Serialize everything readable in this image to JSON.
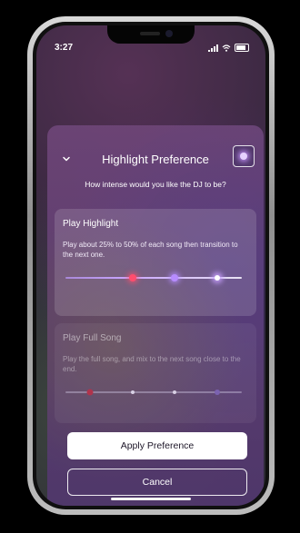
{
  "status_bar": {
    "time": "3:27"
  },
  "sheet": {
    "title": "Highlight Preference",
    "subtitle": "How intense would you like the DJ to be?"
  },
  "options": [
    {
      "title": "Play Highlight",
      "description": "Play about 25% to 50% of each song then transition to the next one.",
      "selected": true
    },
    {
      "title": "Play Full Song",
      "description": "Play the full song, and mix to the next song close to the end.",
      "selected": false
    }
  ],
  "buttons": {
    "apply": "Apply Preference",
    "cancel": "Cancel"
  },
  "icons": {
    "collapse": "chevron-down-icon",
    "dj": "dj-indicator-icon"
  },
  "colors": {
    "accent_red": "#ff4d6d",
    "accent_violet": "#b78cff",
    "apply_bg": "#ffffff"
  }
}
